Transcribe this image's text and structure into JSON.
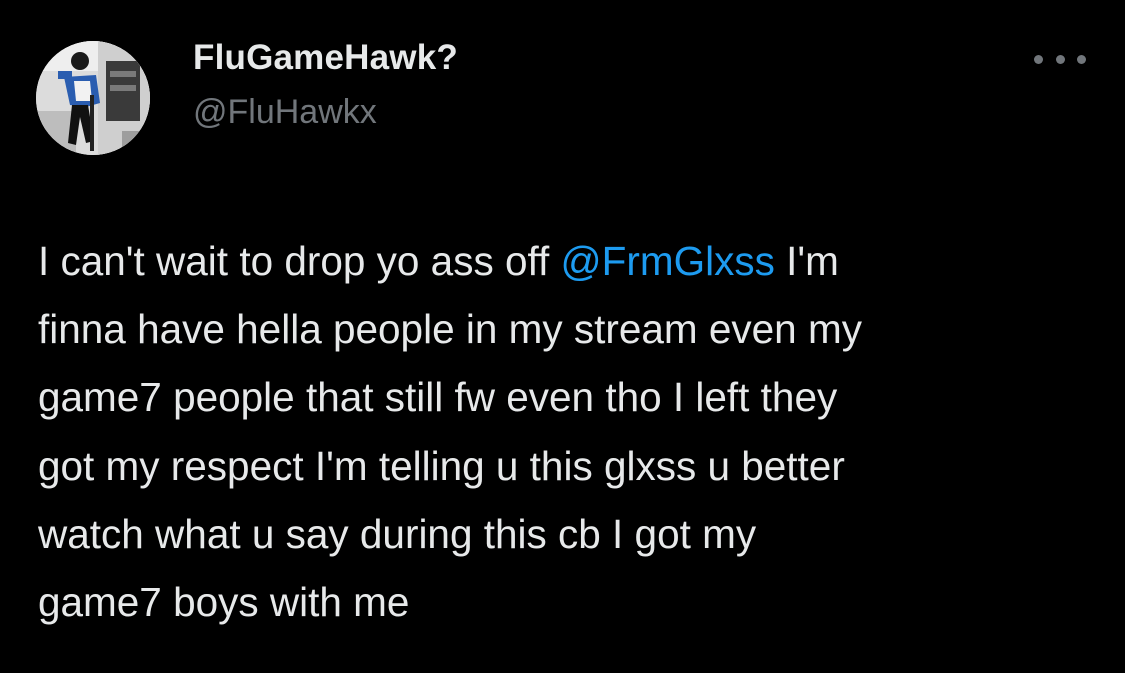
{
  "tweet": {
    "author": {
      "display_name": "FluGameHawk?",
      "handle": "@FluHawkx",
      "avatar_icon": "profile-photo"
    },
    "more_icon": "more-horizontal-icon",
    "text": {
      "before_mention": "I can't wait to drop yo ass off ",
      "mention": "@FrmGlxss",
      "after_mention": " I'm",
      "line2": "finna have hella people in my stream even my",
      "line3": "game7 people that still fw even tho I left they",
      "line4": "got my respect I'm telling u this glxss u better",
      "line5": "watch what u say during this cb I got my",
      "line6": "game7 boys with me"
    }
  },
  "colors": {
    "background": "#000000",
    "text_primary": "#e7e9ea",
    "text_secondary": "#71767b",
    "mention": "#1d9bf0"
  }
}
